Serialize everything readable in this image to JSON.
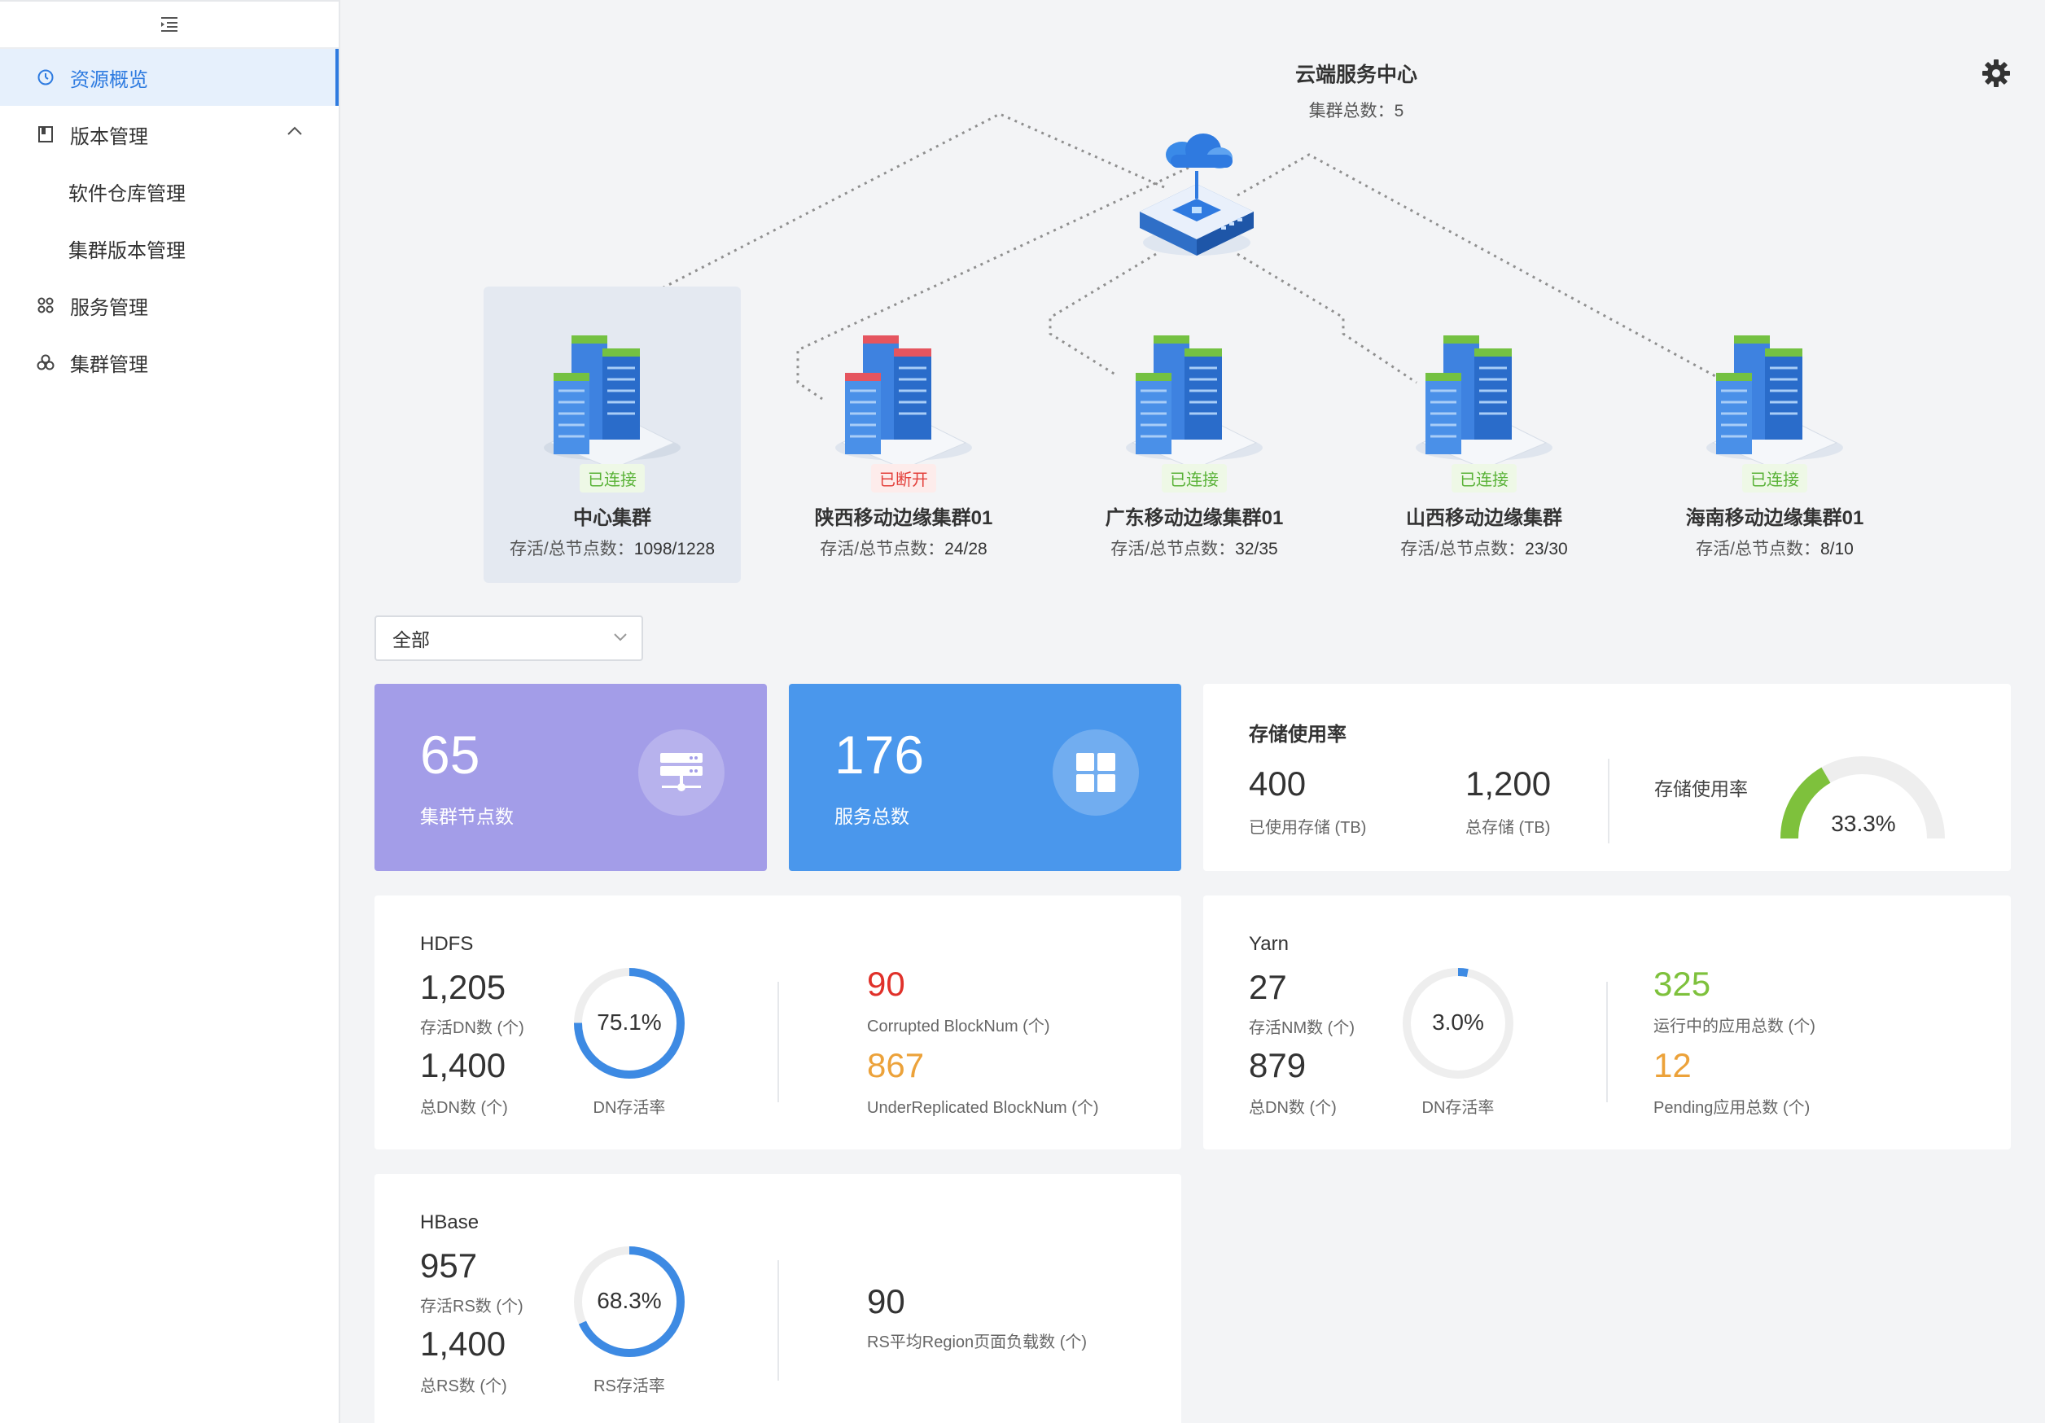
{
  "sidebar": {
    "items": [
      {
        "label": "资源概览",
        "icon": "dashboard-icon",
        "active": true
      },
      {
        "label": "版本管理",
        "icon": "book-icon",
        "expanded": true
      },
      {
        "label": "软件仓库管理"
      },
      {
        "label": "集群版本管理"
      },
      {
        "label": "服务管理",
        "icon": "services-icon"
      },
      {
        "label": "集群管理",
        "icon": "cluster-icon"
      }
    ]
  },
  "topology": {
    "center_name": "云端服务中心",
    "center_count": "集群总数：5",
    "clusters": [
      {
        "status": "已连接",
        "state": "connected",
        "name": "中心集群",
        "nodes_label": "存活/总节点数：",
        "nodes": "1098/1228"
      },
      {
        "status": "已断开",
        "state": "disconnected",
        "name": "陕西移动边缘集群01",
        "nodes_label": "存活/总节点数：",
        "nodes": "24/28"
      },
      {
        "status": "已连接",
        "state": "connected",
        "name": "广东移动边缘集群01",
        "nodes_label": "存活/总节点数：",
        "nodes": "32/35"
      },
      {
        "status": "已连接",
        "state": "connected",
        "name": "山西移动边缘集群",
        "nodes_label": "存活/总节点数：",
        "nodes": "23/30"
      },
      {
        "status": "已连接",
        "state": "connected",
        "name": "海南移动边缘集群01",
        "nodes_label": "存活/总节点数：",
        "nodes": "8/10"
      }
    ]
  },
  "filter": {
    "selected": "全部"
  },
  "stats": {
    "nodes": {
      "value": "65",
      "label": "集群节点数",
      "color": "#a39de8"
    },
    "services": {
      "value": "176",
      "label": "服务总数",
      "color": "#4a97ec"
    }
  },
  "storage": {
    "title": "存储使用率",
    "used": "400",
    "used_label": "已使用存储 (TB)",
    "total": "1,200",
    "total_label": "总存储 (TB)",
    "gauge_label": "存储使用率",
    "rate_text": "33.3%",
    "rate": 0.333
  },
  "hdfs": {
    "title": "HDFS",
    "alive": "1,205",
    "alive_label": "存活DN数 (个)",
    "total": "1,400",
    "total_label": "总DN数 (个)",
    "rate_text": "75.1%",
    "rate": 0.751,
    "rate_label": "DN存活率",
    "corrupted": "90",
    "corrupted_label": "Corrupted BlockNum (个)",
    "under": "867",
    "under_label": "UnderReplicated BlockNum (个)"
  },
  "yarn": {
    "title": "Yarn",
    "alive": "27",
    "alive_label": "存活NM数 (个)",
    "total": "879",
    "total_label": "总DN数 (个)",
    "rate_text": "3.0%",
    "rate": 0.03,
    "rate_label": "DN存活率",
    "running": "325",
    "running_label": "运行中的应用总数 (个)",
    "pending": "12",
    "pending_label": "Pending应用总数 (个)"
  },
  "hbase": {
    "title": "HBase",
    "alive": "957",
    "alive_label": "存活RS数 (个)",
    "total": "1,400",
    "total_label": "总RS数 (个)",
    "rate_text": "68.3%",
    "rate": 0.683,
    "rate_label": "RS存活率",
    "region": "90",
    "region_label": "RS平均Region页面负载数 (个)"
  },
  "colors": {
    "accent": "#2e7be0",
    "ring": "#3d8ae3",
    "green": "#7ec13c",
    "red": "#e0312a",
    "orange": "#eca23a",
    "track": "#eeeeee"
  }
}
